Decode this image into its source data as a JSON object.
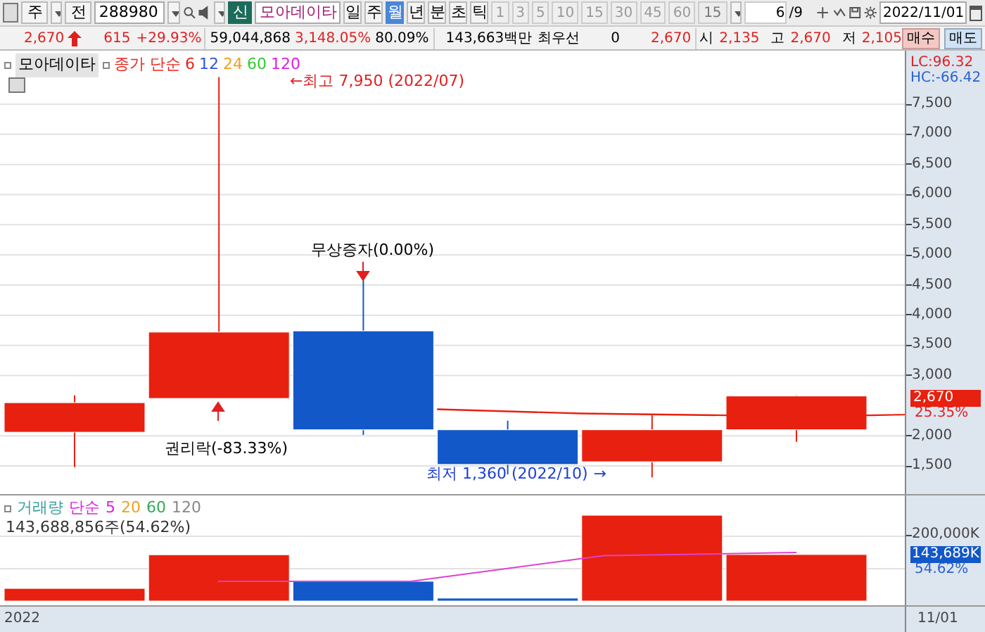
{
  "toolbar": {
    "market": "주",
    "all_button": "전",
    "code": "288980",
    "new_button": "신",
    "stock_name": "모아데이타",
    "periods": [
      {
        "label": "일",
        "selected": false
      },
      {
        "label": "주",
        "selected": false
      },
      {
        "label": "월",
        "selected": true
      },
      {
        "label": "년",
        "selected": false
      }
    ],
    "units": [
      {
        "label": "분",
        "selected": false
      },
      {
        "label": "초",
        "selected": false
      },
      {
        "label": "틱",
        "selected": false
      }
    ],
    "intervals": [
      {
        "label": "1",
        "disabled": true
      },
      {
        "label": "3",
        "disabled": true
      },
      {
        "label": "5",
        "disabled": true
      },
      {
        "label": "10",
        "disabled": true
      },
      {
        "label": "15",
        "disabled": true
      },
      {
        "label": "30",
        "disabled": true
      },
      {
        "label": "45",
        "disabled": true
      },
      {
        "label": "60",
        "disabled": true
      }
    ],
    "interval_select": "15",
    "page": "6",
    "page_total": "/9",
    "date": "2022/11/01"
  },
  "quote": {
    "price": "2,670",
    "change": "615",
    "change_rate": "+29.93%",
    "volume": "59,044,868",
    "volume_rate": "3,148.05%",
    "turnover": "80.09%",
    "amount": "143,663백만",
    "best_label": "최우선",
    "best_value": "0",
    "best_price": "2,670",
    "open_label": "시",
    "open": "2,135",
    "high_label": "고",
    "high": "2,670",
    "low_label": "저",
    "low": "2,105",
    "buy": "매수",
    "sell": "매도"
  },
  "price_chart": {
    "name_tag": "모아데이타",
    "ma_label": "종가 단순",
    "ma_legend": [
      {
        "label": "6",
        "color": "#e8231a"
      },
      {
        "label": "12",
        "color": "#2e55d6"
      },
      {
        "label": "24",
        "color": "#f0a020"
      },
      {
        "label": "60",
        "color": "#33cc33"
      },
      {
        "label": "120",
        "color": "#e020e0"
      }
    ],
    "annotations": [
      {
        "kind": "high",
        "text": "←최고 7,950 (2022/07)"
      },
      {
        "kind": "event_above",
        "text": "무상증자(0.00%)"
      },
      {
        "kind": "event_below",
        "text": "권리락(-83.33%)"
      },
      {
        "kind": "low",
        "text": "최저 1,360 (2022/10)",
        "arrow": "→"
      }
    ],
    "lc": "LC:96.32",
    "hc": "HC:-66.42",
    "yticks": [
      "7,500",
      "7,000",
      "6,500",
      "6,000",
      "5,500",
      "5,000",
      "4,500",
      "4,000",
      "3,500",
      "3,000",
      "2,000",
      "1,500"
    ],
    "price_tag": "2,670",
    "price_rate": "25.35%"
  },
  "volume_chart": {
    "label": "거래량",
    "ma_label": "단순",
    "ma_legend": [
      {
        "label": "5",
        "color": "#e020e0"
      },
      {
        "label": "20",
        "color": "#f0a020"
      },
      {
        "label": "60",
        "color": "#33aa55"
      },
      {
        "label": "120",
        "color": "#888888"
      }
    ],
    "current": "143,688,856주(54.62%)",
    "ytick": "200,000K",
    "tag": "143,689K",
    "tag_rate": "54.62%"
  },
  "x_axis": {
    "start": "2022",
    "end": "11/01"
  }
}
